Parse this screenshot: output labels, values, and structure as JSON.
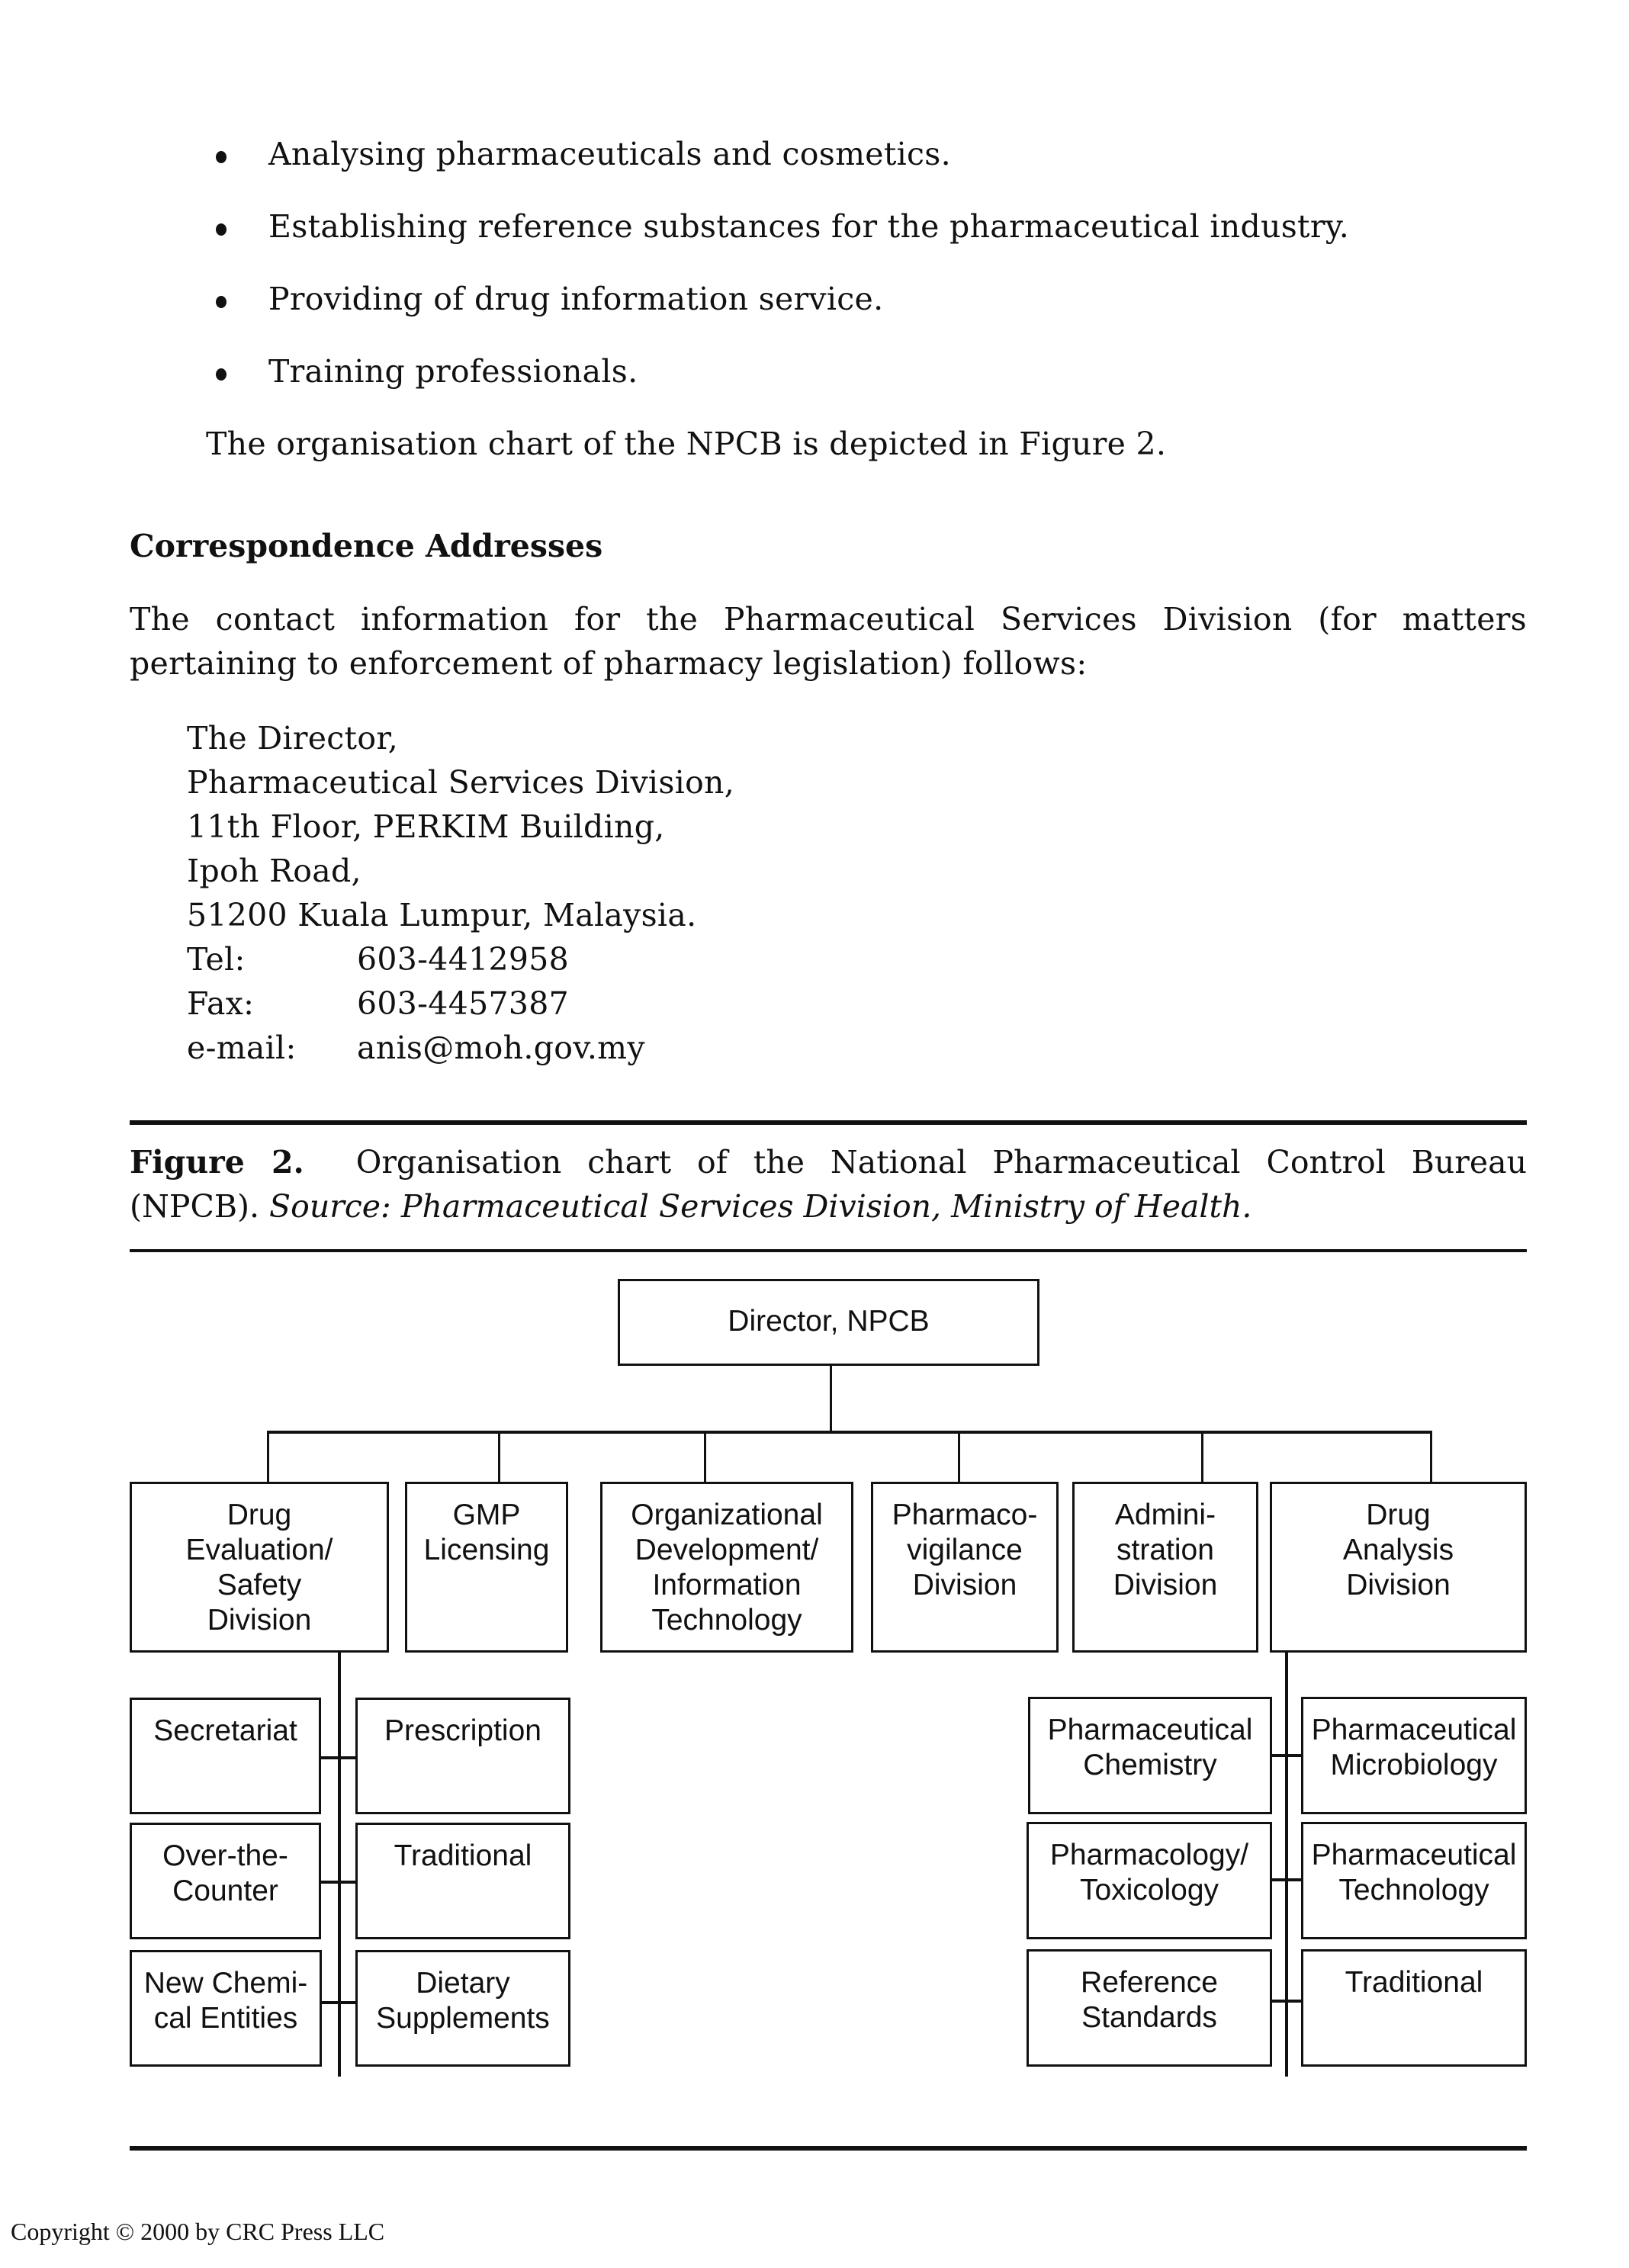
{
  "bullets": [
    "Analysing pharmaceuticals and cosmetics.",
    "Establishing reference substances for the pharmaceutical industry.",
    "Providing of drug information service.",
    "Training professionals."
  ],
  "intro_sentence": "The organisation chart of the NPCB is depicted in Figure 2.",
  "section": {
    "heading": "Correspondence Addresses",
    "paragraph_line1": "The contact information for the Pharmaceutical Services Division (for matters",
    "paragraph_line2": "pertaining to enforcement of pharmacy legislation) follows:"
  },
  "address": {
    "lines": [
      "The Director,",
      "Pharmaceutical Services Division,",
      "11th Floor, PERKIM Building,",
      "Ipoh Road,",
      "51200 Kuala Lumpur, Malaysia."
    ],
    "contacts": [
      {
        "label": "Tel:",
        "value": "603-4412958"
      },
      {
        "label": "Fax:",
        "value": "603-4457387"
      },
      {
        "label": "e-mail:",
        "value": "anis@moh.gov.my"
      }
    ]
  },
  "figure": {
    "label": "Figure 2.",
    "title_line1": "Organisation chart of the National Pharmaceutical Control Bureau",
    "title_line2_plain": "(NPCB).",
    "source_italic": "Source: Pharmaceutical Services Division, Ministry of Health."
  },
  "org_chart": {
    "root": "Director, NPCB",
    "divisions": [
      "Drug\nEvaluation/\nSafety\nDivision",
      "GMP\nLicensing",
      "Organizational\nDevelopment/\nInformation\nTechnology",
      "Pharmaco-\nvigilance\nDivision",
      "Admini-\nstration\nDivision",
      "Drug\nAnalysis\nDivision"
    ],
    "drug_evaluation_units": {
      "left": [
        "Secretariat",
        "Over-the-\nCounter",
        "New Chemi-\ncal Entities"
      ],
      "right": [
        "Prescription",
        "Traditional",
        "Dietary\nSupplements"
      ]
    },
    "drug_analysis_units": {
      "left": [
        "Pharmaceutical\nChemistry",
        "Pharmacology/\nToxicology",
        "Reference\nStandards"
      ],
      "right": [
        "Pharmaceutical\nMicrobiology",
        "Pharmaceutical\nTechnology",
        "Traditional"
      ]
    }
  },
  "footer": {
    "copyright": "Copyright © 2000 by CRC Press LLC"
  }
}
